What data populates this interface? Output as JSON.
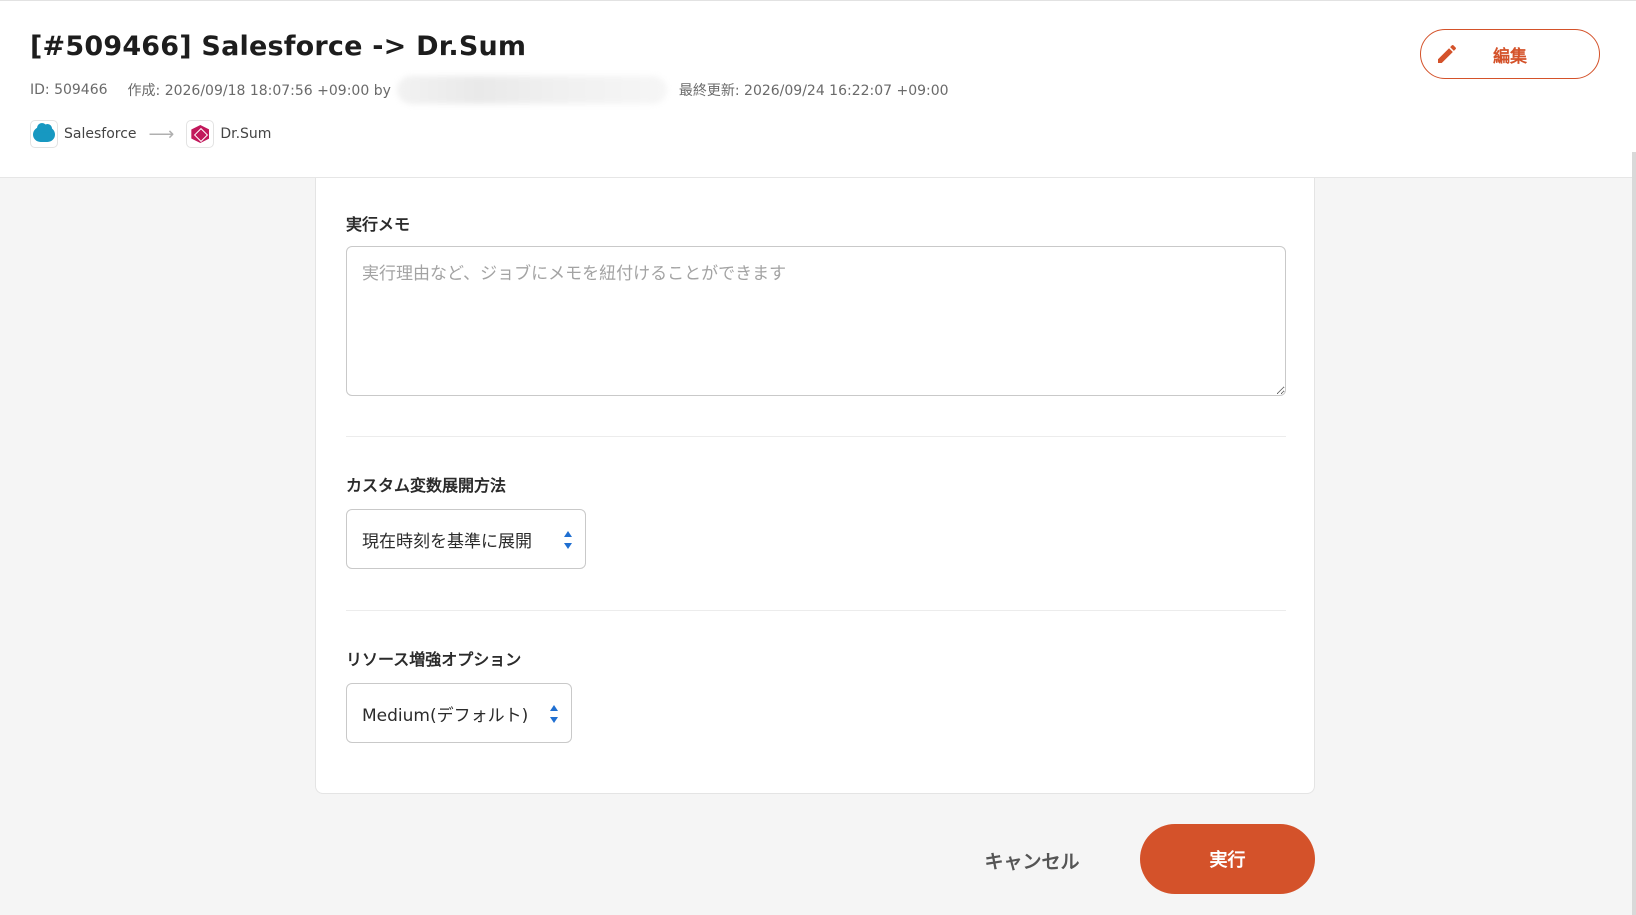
{
  "header": {
    "title": "[#509466] Salesforce -> Dr.Sum",
    "meta": {
      "id": "ID: 509466",
      "created": "作成: 2026/09/18 18:07:56 +09:00 by",
      "updated": "最終更新: 2026/09/24 16:22:07 +09:00"
    },
    "source": {
      "name": "Salesforce",
      "icon": "salesforce-cloud-icon",
      "color": "#1798c1"
    },
    "destination": {
      "name": "Dr.Sum",
      "icon": "drsum-cube-icon",
      "color": "#c2185b"
    },
    "edit_label": "編集"
  },
  "form": {
    "memo": {
      "label": "実行メモ",
      "placeholder": "実行理由など、ジョブにメモを紐付けることができます",
      "value": ""
    },
    "custom_var": {
      "label": "カスタム変数展開方法",
      "selected": "現在時刻を基準に展開"
    },
    "resource": {
      "label": "リソース増強オプション",
      "selected": "Medium(デフォルト)"
    }
  },
  "actions": {
    "cancel_label": "キャンセル",
    "run_label": "実行"
  },
  "colors": {
    "accent": "#d4522a",
    "select_arrow": "#1f6fd1"
  }
}
